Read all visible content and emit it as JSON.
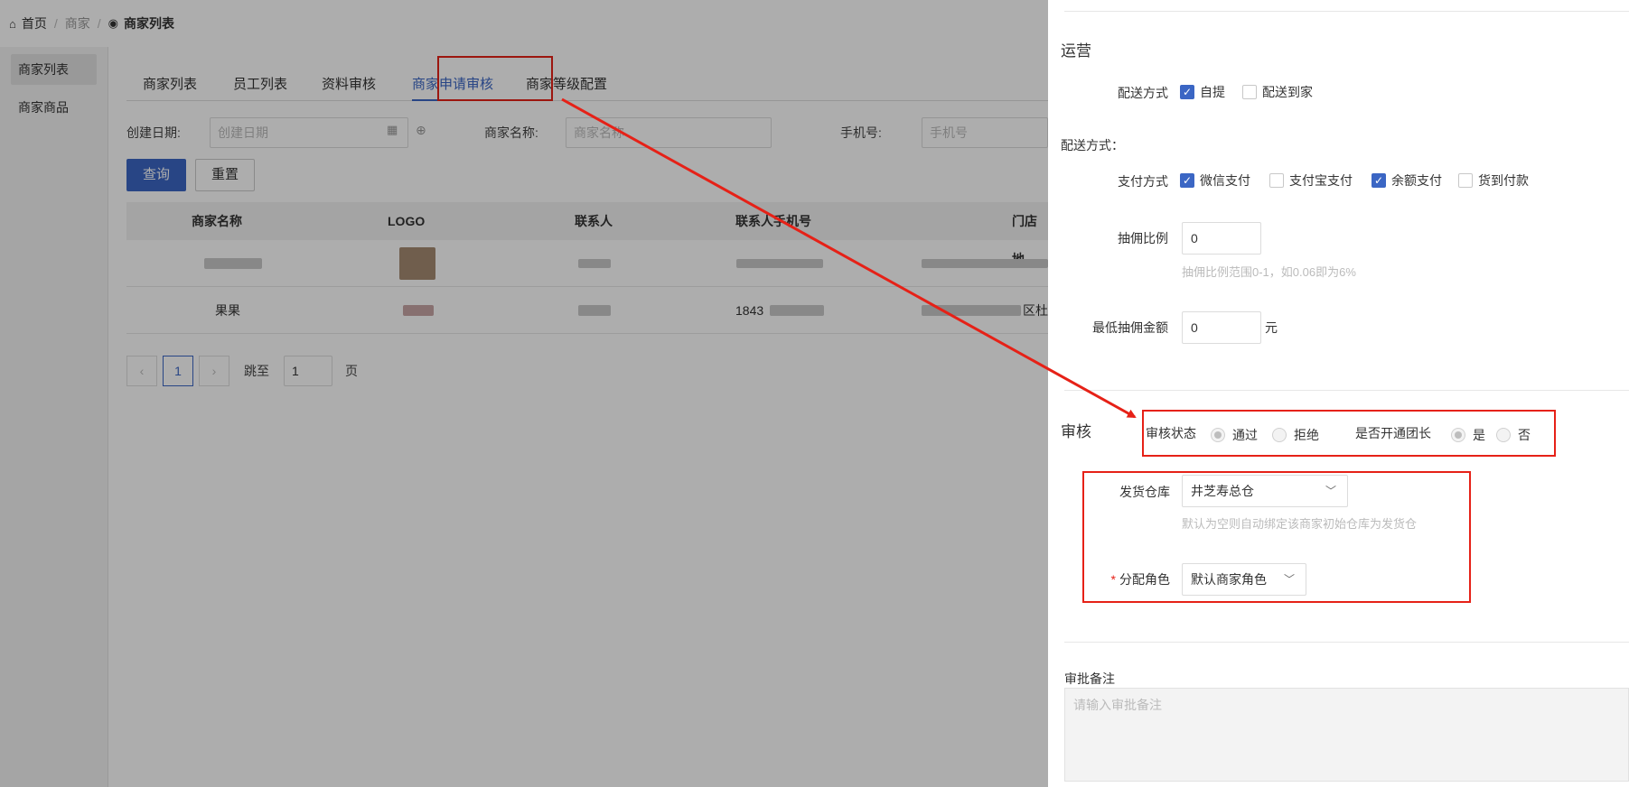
{
  "breadcrumb": {
    "home": "首页",
    "level1": "商家",
    "current": "商家列表"
  },
  "sidebar": {
    "items": [
      {
        "label": "商家列表"
      },
      {
        "label": "商家商品"
      }
    ]
  },
  "tabs": [
    "商家列表",
    "员工列表",
    "资料审核",
    "商家申请审核",
    "商家等级配置"
  ],
  "filters": {
    "date_label": "创建日期:",
    "date_placeholder": "创建日期",
    "name_label": "商家名称:",
    "name_placeholder": "商家名称",
    "phone_label": "手机号:",
    "phone_placeholder": "手机号"
  },
  "buttons": {
    "search": "查询",
    "reset": "重置"
  },
  "table": {
    "columns": [
      "商家名称",
      "LOGO",
      "联系人",
      "联系人手机号",
      "门店地"
    ],
    "rows": [
      {
        "name": "",
        "phone": "",
        "address": ""
      },
      {
        "name": "果果",
        "phone": "1843",
        "address": "区杜"
      }
    ]
  },
  "pagination": {
    "prev": "‹",
    "current": "1",
    "next": "›",
    "jump_label": "跳至",
    "jump_value": "1",
    "page_suffix": "页"
  },
  "drawer": {
    "ops_title": "运营",
    "delivery_label": "配送方式",
    "delivery_options": [
      {
        "label": "自提",
        "checked": true
      },
      {
        "label": "配送到家",
        "checked": false
      }
    ],
    "delivery_heading": "配送方式：",
    "payment_label": "支付方式",
    "payment_options": [
      {
        "label": "微信支付",
        "checked": true
      },
      {
        "label": "支付宝支付",
        "checked": false
      },
      {
        "label": "余额支付",
        "checked": true
      },
      {
        "label": "货到付款",
        "checked": false
      }
    ],
    "commission_label": "抽佣比例",
    "commission_value": "0",
    "commission_hint": "抽佣比例范围0-1，如0.06即为6%",
    "min_commission_label": "最低抽佣金额",
    "min_commission_value": "0",
    "min_commission_unit": "元",
    "review_title": "审核",
    "review_status_label": "审核状态",
    "review_status_options": [
      {
        "label": "通过",
        "selected": true
      },
      {
        "label": "拒绝",
        "selected": false
      }
    ],
    "group_leader_label": "是否开通团长",
    "group_leader_options": [
      {
        "label": "是",
        "selected": true
      },
      {
        "label": "否",
        "selected": false
      }
    ],
    "warehouse_label": "发货仓库",
    "warehouse_value": "井芝寿总仓",
    "warehouse_hint": "默认为空则自动绑定该商家初始仓库为发货仓",
    "role_required": "*",
    "role_label": "分配角色",
    "role_value": "默认商家角色",
    "remark_label": "审批备注",
    "remark_placeholder": "请输入审批备注"
  },
  "colors": {
    "primary": "#3b66c4",
    "highlight": "#e62117",
    "overlay": "rgba(0,0,0,0.32)"
  }
}
